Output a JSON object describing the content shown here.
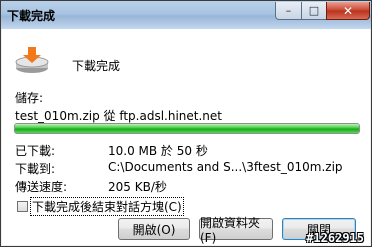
{
  "window": {
    "title": "下載完成"
  },
  "caption_buttons": {
    "minimize": "–",
    "maximize": "□",
    "close": "✕"
  },
  "header": {
    "status": "下載完成",
    "icon": "download-to-drive-icon"
  },
  "save": {
    "label": "儲存:",
    "file_line": "test_010m.zip 從 ftp.adsl.hinet.net"
  },
  "progress": {
    "percent": 100,
    "color": "#14a814"
  },
  "details": {
    "downloaded_label": "已下載:",
    "downloaded_value": "10.0 MB 於 50 秒",
    "download_to_label": "下載到:",
    "download_to_value": "C:\\Documents and S...\\3ftest_010m.zip",
    "speed_label": "傳送速度:",
    "speed_value": "205 KB/秒"
  },
  "close_on_complete": {
    "label": "下載完成後結束對話方塊(C)",
    "checked": false
  },
  "buttons": {
    "open": "開啟(O)",
    "open_folder": "開啟資料夾(F)",
    "close": "關閉"
  },
  "watermark": "#1262915"
}
